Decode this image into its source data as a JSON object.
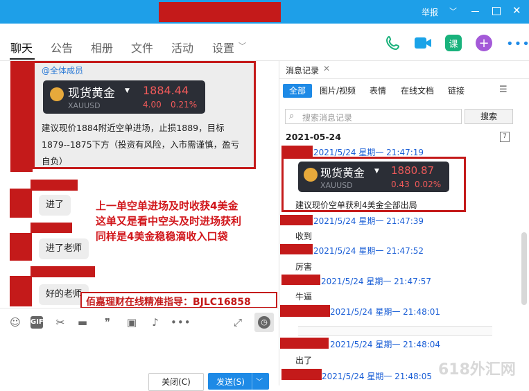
{
  "window": {
    "report_label": "举报",
    "min_icon": "minimize-icon",
    "max_icon": "maximize-icon",
    "close_icon": "close-icon"
  },
  "tabs": [
    {
      "label": "聊天"
    },
    {
      "label": "公告"
    },
    {
      "label": "相册"
    },
    {
      "label": "文件"
    },
    {
      "label": "活动"
    },
    {
      "label": "设置"
    }
  ],
  "chat": {
    "mention": "@全体成员",
    "card1": {
      "title": "现货黄金",
      "code": "XAUUSD",
      "price": "1884.44",
      "change": "4.00",
      "percent": "0.21%"
    },
    "post_line1": "建议现价1884附近空单进场，止损1889，目标",
    "post_line2": "1879--1875下方（投资有风险，入市需谨慎，盈亏",
    "post_line3": "自负）",
    "b1": "进了",
    "b2": "进了老师",
    "b3": "好的老师",
    "overlay1": "上一单空单进场及时收获4美金",
    "overlay2": "这单又是看中空头及时进场获利",
    "overlay3": "同样是4美金稳稳滴收入口袋",
    "banner": "佰嘉理财在线精准指导：BJLC16858"
  },
  "compose": {
    "close_label": "关闭(C)",
    "send_label": "发送(S)"
  },
  "history": {
    "tab_label": "消息记录",
    "filters": [
      "全部",
      "图片/视频",
      "表情",
      "在线文档",
      "链接"
    ],
    "search_placeholder": "搜索消息记录",
    "search_button": "搜索",
    "date": "2021-05-24",
    "entries": [
      {
        "ts": "2021/5/24 星期一 21:47:19"
      },
      {
        "ts": "2021/5/24 星期一 21:47:39",
        "text": "收到"
      },
      {
        "ts": "2021/5/24 星期一 21:47:52",
        "text": "厉害"
      },
      {
        "ts": "2021/5/24 星期一 21:47:57",
        "text": "牛逼"
      },
      {
        "ts": "2021/5/24 星期一 21:48:01"
      },
      {
        "ts": "2021/5/24 星期一 21:48:04",
        "text": "出了"
      },
      {
        "ts": "2021/5/24 星期一 21:48:05"
      }
    ],
    "card2": {
      "title": "现货黄金",
      "code": "XAUUSD",
      "price": "1880.87",
      "change": "0.43",
      "percent": "0.02%"
    },
    "card2_text": "建议现价空单获利4美金全部出局",
    "calendar_num": "7"
  },
  "watermark": "618外汇网",
  "colors": {
    "title_bar": "#1e9fe8",
    "redact": "#c41a1a",
    "link_blue": "#1b5fd6",
    "accent": "#1e8ae6"
  }
}
